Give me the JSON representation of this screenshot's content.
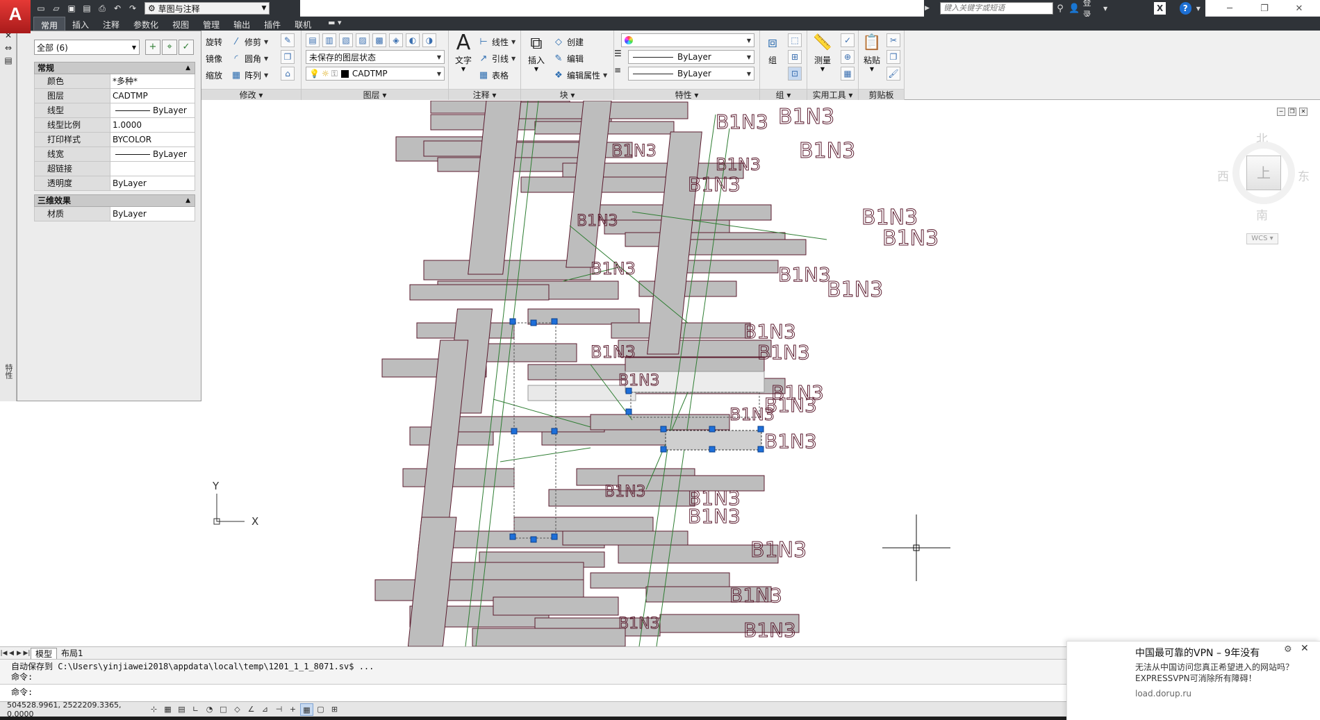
{
  "app": {
    "logo": "A"
  },
  "qat": {
    "workspace": "草图与注释"
  },
  "search": {
    "placeholder": "键入关键字或短语"
  },
  "login": {
    "label": "登录"
  },
  "ribbon_tabs": [
    "常用",
    "插入",
    "注释",
    "参数化",
    "视图",
    "管理",
    "输出",
    "插件",
    "联机"
  ],
  "ribbon": {
    "modify": {
      "title": "修改",
      "rotate": "旋转",
      "trim": "修剪",
      "mirror": "镜像",
      "fillet": "圆角",
      "scale": "缩放",
      "array": "阵列"
    },
    "layers": {
      "title": "图层",
      "state": "未保存的图层状态",
      "current": "CADTMP"
    },
    "annotation": {
      "title": "注释",
      "text": "文字",
      "linear": "线性",
      "leader": "引线",
      "table": "表格"
    },
    "block": {
      "title": "块",
      "insert": "插入",
      "create": "创建",
      "edit": "编辑",
      "edit_attr": "编辑属性"
    },
    "properties": {
      "title": "特性",
      "linetype": "ByLayer",
      "lineweight": "ByLayer"
    },
    "groups": {
      "title": "组",
      "group": "组"
    },
    "utilities": {
      "title": "实用工具",
      "measure": "测量"
    },
    "clipboard": {
      "title": "剪贴板",
      "paste": "粘贴"
    }
  },
  "properties": {
    "selection": "全部 (6)",
    "vertical_tab": "特性",
    "general": {
      "title": "常规",
      "rows": [
        {
          "name": "颜色",
          "value": "*多种*"
        },
        {
          "name": "图层",
          "value": "CADTMP"
        },
        {
          "name": "线型",
          "value": "ByLayer"
        },
        {
          "name": "线型比例",
          "value": "1.0000"
        },
        {
          "name": "打印样式",
          "value": "BYCOLOR"
        },
        {
          "name": "线宽",
          "value": "ByLayer"
        },
        {
          "name": "超链接",
          "value": ""
        },
        {
          "name": "透明度",
          "value": "ByLayer"
        }
      ]
    },
    "3d": {
      "title": "三维效果",
      "rows": [
        {
          "name": "材质",
          "value": "ByLayer"
        }
      ]
    }
  },
  "viewcube": {
    "north": "北",
    "south": "南",
    "east": "东",
    "west": "西",
    "face": "上",
    "wcs": "WCS"
  },
  "drawing": {
    "label": "B1N3",
    "axis_x": "X",
    "axis_y": "Y"
  },
  "layout_tabs": {
    "model": "模型",
    "layout1": "布局1"
  },
  "command": {
    "history1": "自动保存到 C:\\Users\\yinjiawei2018\\appdata\\local\\temp\\1201_1_1_8071.sv$ ...",
    "history2": "命令:",
    "prompt": "命令:"
  },
  "status": {
    "coords": "504528.9961, 2522209.3365, 0.0000"
  },
  "toast": {
    "title": "中国最可靠的VPN – 9年没有",
    "body1": "无法从中国访问您真正希望进入的网站吗？",
    "body2": "EXPRESSVPN可消除所有障碍！",
    "url": "load.dorup.ru"
  }
}
